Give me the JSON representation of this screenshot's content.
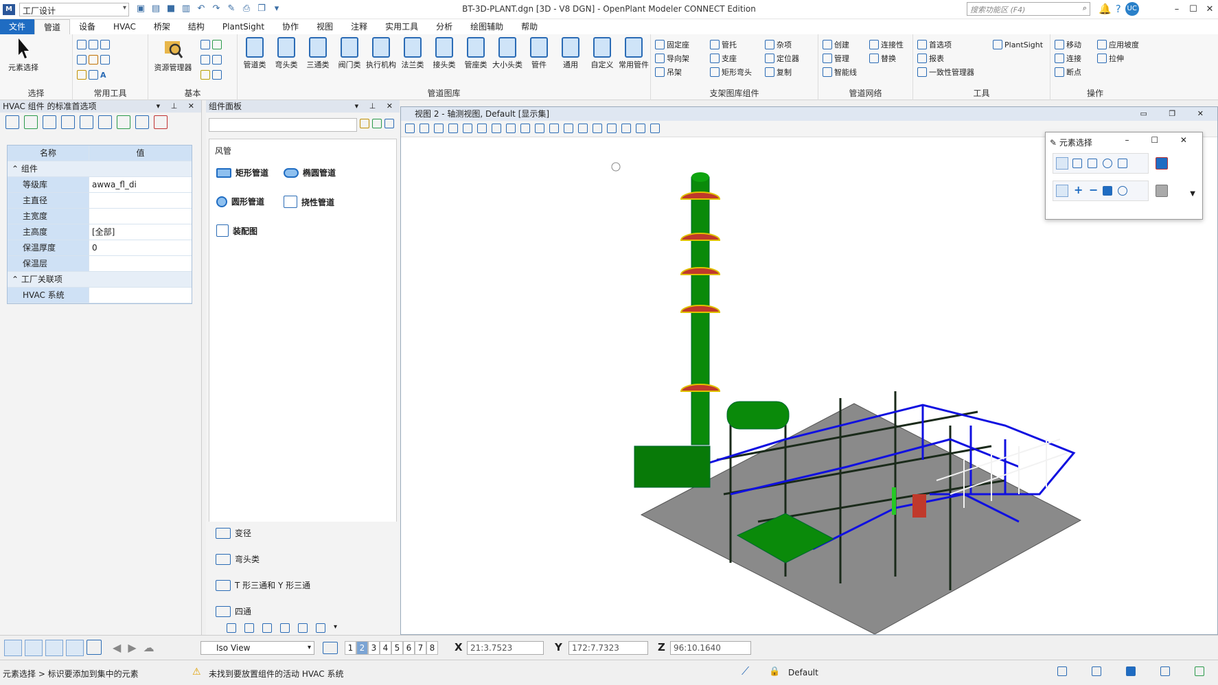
{
  "app": {
    "title": "BT-3D-PLANT.dgn [3D - V8 DGN] - OpenPlant Modeler CONNECT Edition",
    "workspace": "工厂设计",
    "search_placeholder": "搜索功能区 (F4)",
    "user": "UC"
  },
  "tabs": [
    "文件",
    "管道",
    "设备",
    "HVAC",
    "桥架",
    "结构",
    "PlantSight",
    "协作",
    "视图",
    "注释",
    "实用工具",
    "分析",
    "绘图辅助",
    "帮助"
  ],
  "ribbon": {
    "select": {
      "label": "选择",
      "btn": "元素选择"
    },
    "common": {
      "label": "常用工具"
    },
    "basic": {
      "label": "基本",
      "btn": "资源管理器"
    },
    "catalog": {
      "label": "管道图库",
      "items": [
        "管道类",
        "弯头类",
        "三通类",
        "阀门类",
        "执行机构",
        "法兰类",
        "接头类",
        "管座类",
        "大小头类",
        "管件",
        "通用",
        "自定义",
        "常用管件"
      ]
    },
    "support": {
      "label": "支架图库组件",
      "items": [
        "固定座",
        "导向架",
        "吊架",
        "管托",
        "支座",
        "矩形弯头",
        "杂项",
        "定位器",
        "复制"
      ]
    },
    "network": {
      "label": "管道网络",
      "items": [
        "创建",
        "管理",
        "智能线",
        "连接性",
        "替换"
      ]
    },
    "tools": {
      "label": "工具",
      "items": [
        "首选项",
        "报表",
        "一致性管理器",
        "PlantSight"
      ]
    },
    "ops": {
      "label": "操作",
      "items": [
        "移动",
        "连接",
        "断点",
        "应用坡度",
        "拉伸"
      ]
    }
  },
  "left_panel": {
    "title": "HVAC 组件 的标准首选项",
    "col_name": "名称",
    "col_value": "值",
    "groups": [
      {
        "name": "组件",
        "rows": [
          [
            "等级库",
            "awwa_fl_di"
          ],
          [
            "主直径",
            ""
          ],
          [
            "主宽度",
            ""
          ],
          [
            "主高度",
            "[全部]"
          ],
          [
            "保温厚度",
            "0"
          ],
          [
            "保温层",
            ""
          ]
        ]
      },
      {
        "name": "工厂关联项",
        "rows": [
          [
            "HVAC 系统",
            ""
          ]
        ]
      }
    ]
  },
  "comp_panel": {
    "title": "组件面板",
    "section": "风管",
    "items": [
      "矩形管道",
      "椭圆管道",
      "圆形管道",
      "挠性管道",
      "装配图"
    ],
    "list": [
      "风管",
      "变径",
      "弯头类",
      "T 形三通和 Y 形三通",
      "四通"
    ]
  },
  "view": {
    "title": "视图 2 - 轴测视图, Default [显示集]"
  },
  "float": {
    "title": "元素选择"
  },
  "bottom": {
    "view_combo": "Iso View",
    "pages": [
      "1",
      "2",
      "3",
      "4",
      "5",
      "6",
      "7",
      "8"
    ],
    "x": "21:3.7523",
    "y": "172:7.7323",
    "z": "96:10.1640"
  },
  "status": {
    "left": "元素选择 > 标识要添加到集中的元素",
    "warn": "未找到要放置组件的活动 HVAC 系统",
    "level": "Default"
  },
  "colors": {
    "file_tab": "#1f6cc2",
    "tower": "#0a8a0a",
    "pipe": "#1010e0",
    "floor": "#8a8a8a"
  }
}
